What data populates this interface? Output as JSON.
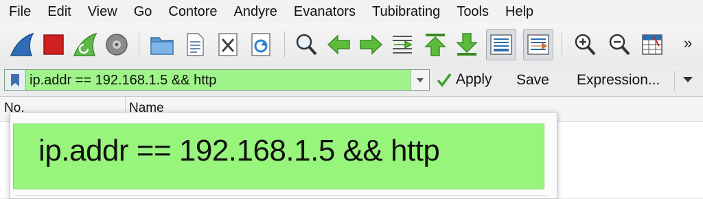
{
  "menu": [
    "File",
    "Edit",
    "View",
    "Go",
    "Contore",
    "Andyre",
    "Evanators",
    "Tubibrating",
    "Tools",
    "Help"
  ],
  "toolbar": {
    "buttons": [
      "start-capture",
      "stop-capture",
      "restart-capture",
      "capture-options",
      "open-file",
      "save-file",
      "close-file",
      "reload-file",
      "find-packet",
      "go-back",
      "go-forward",
      "go-to-packet",
      "go-first",
      "go-last",
      "auto-scroll",
      "colorize",
      "zoom-in",
      "zoom-out",
      "resize-columns"
    ],
    "overflow": "»"
  },
  "filter": {
    "value": "ip.addr == 192.168.1.5 && http",
    "apply_label": "Apply",
    "save_label": "Save",
    "expression_label": "Expression..."
  },
  "columns": [
    "No.",
    "Name"
  ],
  "popup": {
    "value": "ip.addr == 192.168.1.5 && http"
  },
  "colors": {
    "filter_valid": "#9ff589",
    "accent": "#2a6db0"
  }
}
